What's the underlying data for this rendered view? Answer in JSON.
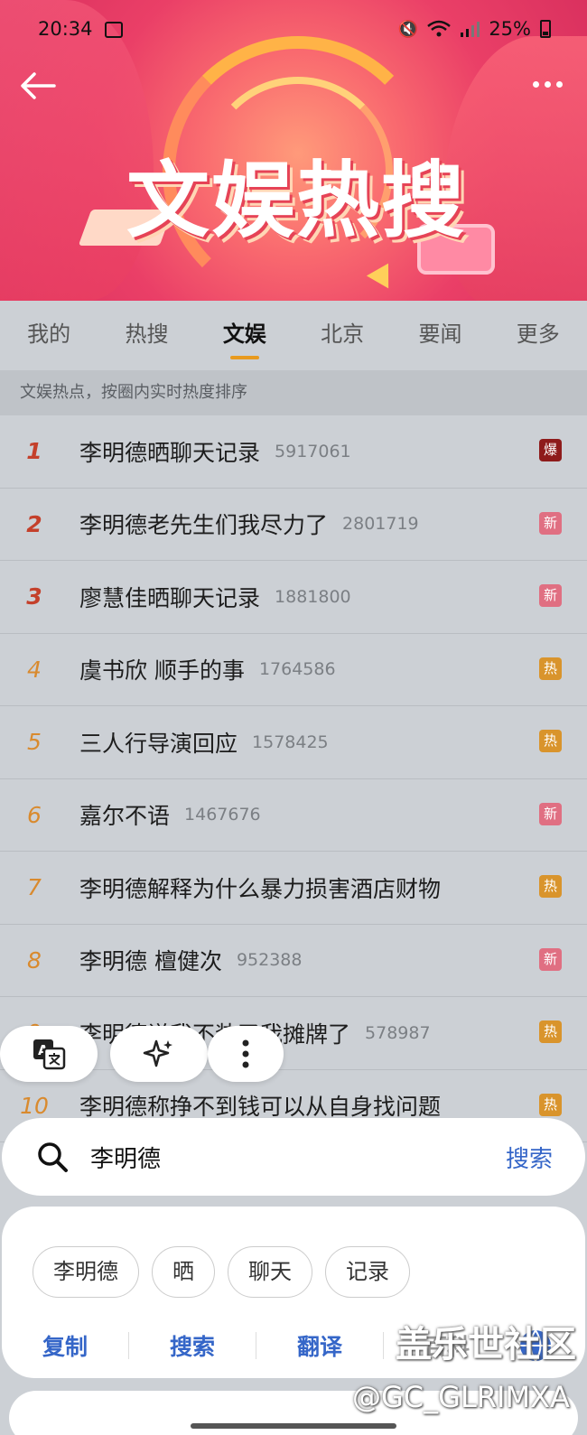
{
  "status": {
    "time": "20:34",
    "battery": "25%"
  },
  "banner": {
    "title": "文娱热搜"
  },
  "tabs": [
    "我的",
    "热搜",
    "文娱",
    "北京",
    "要闻",
    "更多"
  ],
  "active_tab": "文娱",
  "subheading": "文娱热点，按圈内实时热度排序",
  "rows": [
    {
      "rank": "1",
      "text": "李明德晒聊天记录",
      "heat": "5917061",
      "badge": "爆"
    },
    {
      "rank": "2",
      "text": "李明德老先生们我尽力了",
      "heat": "2801719",
      "badge": "新"
    },
    {
      "rank": "3",
      "text": "廖慧佳晒聊天记录",
      "heat": "1881800",
      "badge": "新"
    },
    {
      "rank": "4",
      "text": "虞书欣 顺手的事",
      "heat": "1764586",
      "badge": "热"
    },
    {
      "rank": "5",
      "text": "三人行导演回应",
      "heat": "1578425",
      "badge": "热"
    },
    {
      "rank": "6",
      "text": "嘉尔不语",
      "heat": "1467676",
      "badge": "新"
    },
    {
      "rank": "7",
      "text": "李明德解释为什么暴力损害酒店财物",
      "heat": "",
      "badge": "热"
    },
    {
      "rank": "8",
      "text": "李明德 檀健次",
      "heat": "952388",
      "badge": "新"
    },
    {
      "rank": "9",
      "text": "李明德说我不装了我摊牌了",
      "heat": "578987",
      "badge": "热"
    },
    {
      "rank": "10",
      "text": "李明德称挣不到钱可以从自身找问题",
      "heat": "",
      "badge": "热"
    }
  ],
  "search": {
    "query": "李明德",
    "button": "搜索"
  },
  "chips": [
    "李明德",
    "晒",
    "聊天",
    "记录"
  ],
  "actions": [
    "复制",
    "搜索",
    "翻译",
    "百科"
  ],
  "watermark": {
    "line1": "盖乐世社区",
    "line2": "@GC_GLRIMXA"
  },
  "colors": {
    "accent": "#e89a1e",
    "link": "#3566c8",
    "badge_bao": "#8e1b1b",
    "badge_xin": "#e06f82",
    "badge_re": "#d9942c"
  }
}
